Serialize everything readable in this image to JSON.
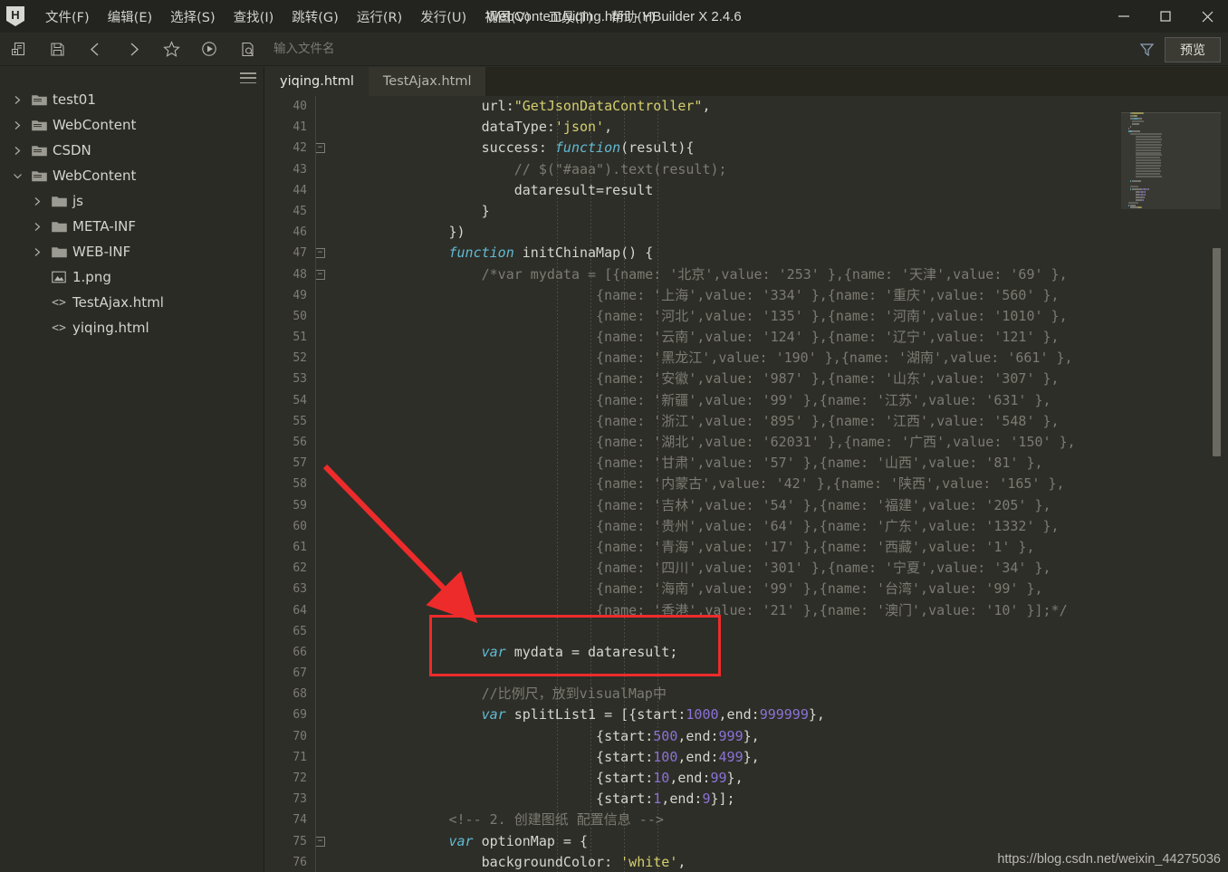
{
  "window": {
    "title": "WebContent/yiqing.html - HBuilder X 2.4.6",
    "logo_letter": "H",
    "minimize": "—",
    "maximize": "▢",
    "close": "✕"
  },
  "menubar": {
    "items": [
      {
        "label": "文件(F)",
        "name": "menu-file"
      },
      {
        "label": "编辑(E)",
        "name": "menu-edit"
      },
      {
        "label": "选择(S)",
        "name": "menu-select"
      },
      {
        "label": "查找(I)",
        "name": "menu-find"
      },
      {
        "label": "跳转(G)",
        "name": "menu-goto"
      },
      {
        "label": "运行(R)",
        "name": "menu-run"
      },
      {
        "label": "发行(U)",
        "name": "menu-publish"
      },
      {
        "label": "视图(V)",
        "name": "menu-view"
      },
      {
        "label": "工具(T)",
        "name": "menu-tools"
      },
      {
        "label": "帮助(Y)",
        "name": "menu-help"
      }
    ]
  },
  "toolbar": {
    "icons": [
      "new-file-icon",
      "save-icon",
      "back-icon",
      "forward-icon",
      "favorite-icon",
      "run-icon",
      "file-search-icon"
    ],
    "file_input_placeholder": "输入文件名",
    "file_input_value": "",
    "filter_icon": "filter-icon",
    "preview_label": "预览"
  },
  "sidebar": {
    "hamburger_icon": "menu-hamburger-icon",
    "tree": [
      {
        "label": "test01",
        "icon": "folder-icon",
        "depth": 0,
        "twisty": "collapsed"
      },
      {
        "label": "WebContent",
        "icon": "folder-icon",
        "depth": 0,
        "twisty": "collapsed"
      },
      {
        "label": "CSDN",
        "icon": "folder-icon",
        "depth": 0,
        "twisty": "collapsed"
      },
      {
        "label": "WebContent",
        "icon": "folder-icon",
        "depth": 0,
        "twisty": "expanded"
      },
      {
        "label": "js",
        "icon": "folder-icon",
        "depth": 1,
        "twisty": "collapsed"
      },
      {
        "label": "META-INF",
        "icon": "folder-icon",
        "depth": 1,
        "twisty": "collapsed"
      },
      {
        "label": "WEB-INF",
        "icon": "folder-icon",
        "depth": 1,
        "twisty": "collapsed"
      },
      {
        "label": "1.png",
        "icon": "image-icon",
        "depth": 1,
        "twisty": "none"
      },
      {
        "label": "TestAjax.html",
        "icon": "code-file-icon",
        "depth": 1,
        "twisty": "none"
      },
      {
        "label": "yiqing.html",
        "icon": "code-file-icon",
        "depth": 1,
        "twisty": "none"
      }
    ]
  },
  "editor": {
    "tabs": [
      {
        "label": "yiqing.html",
        "active": true
      },
      {
        "label": "TestAjax.html",
        "active": false
      }
    ],
    "first_line_number": 40,
    "fold_lines": [
      42,
      47,
      48,
      75
    ],
    "lines": [
      {
        "n": 40,
        "tokens": [
          {
            "t": "                    url:",
            "c": "plain"
          },
          {
            "t": "\"GetJsonDataController\"",
            "c": "str"
          },
          {
            "t": ",",
            "c": "plain"
          }
        ]
      },
      {
        "n": 41,
        "tokens": [
          {
            "t": "                    dataType:",
            "c": "plain"
          },
          {
            "t": "'json'",
            "c": "str"
          },
          {
            "t": ",",
            "c": "plain"
          }
        ]
      },
      {
        "n": 42,
        "tokens": [
          {
            "t": "                    success: ",
            "c": "plain"
          },
          {
            "t": "function",
            "c": "kw"
          },
          {
            "t": "(result){",
            "c": "plain"
          }
        ]
      },
      {
        "n": 43,
        "tokens": [
          {
            "t": "                        // $(\"#aaa\").text(result);",
            "c": "cmt"
          }
        ]
      },
      {
        "n": 44,
        "tokens": [
          {
            "t": "                        dataresult=result",
            "c": "plain"
          }
        ]
      },
      {
        "n": 45,
        "tokens": [
          {
            "t": "                    }",
            "c": "plain"
          }
        ]
      },
      {
        "n": 46,
        "tokens": [
          {
            "t": "                })",
            "c": "plain"
          }
        ]
      },
      {
        "n": 47,
        "tokens": [
          {
            "t": "                ",
            "c": "plain"
          },
          {
            "t": "function",
            "c": "kw"
          },
          {
            "t": " initChinaMap() {",
            "c": "plain"
          }
        ]
      },
      {
        "n": 48,
        "tokens": [
          {
            "t": "                    /*var mydata = [{name: '北京',value: '253' },{name: '天津',value: '69' },",
            "c": "cmt"
          }
        ]
      },
      {
        "n": 49,
        "tokens": [
          {
            "t": "                                  {name: '上海',value: '334' },{name: '重庆',value: '560' },",
            "c": "cmt"
          }
        ]
      },
      {
        "n": 50,
        "tokens": [
          {
            "t": "                                  {name: '河北',value: '135' },{name: '河南',value: '1010' },",
            "c": "cmt"
          }
        ]
      },
      {
        "n": 51,
        "tokens": [
          {
            "t": "                                  {name: '云南',value: '124' },{name: '辽宁',value: '121' },",
            "c": "cmt"
          }
        ]
      },
      {
        "n": 52,
        "tokens": [
          {
            "t": "                                  {name: '黑龙江',value: '190' },{name: '湖南',value: '661' },",
            "c": "cmt"
          }
        ]
      },
      {
        "n": 53,
        "tokens": [
          {
            "t": "                                  {name: '安徽',value: '987' },{name: '山东',value: '307' },",
            "c": "cmt"
          }
        ]
      },
      {
        "n": 54,
        "tokens": [
          {
            "t": "                                  {name: '新疆',value: '99' },{name: '江苏',value: '631' },",
            "c": "cmt"
          }
        ]
      },
      {
        "n": 55,
        "tokens": [
          {
            "t": "                                  {name: '浙江',value: '895' },{name: '江西',value: '548' },",
            "c": "cmt"
          }
        ]
      },
      {
        "n": 56,
        "tokens": [
          {
            "t": "                                  {name: '湖北',value: '62031' },{name: '广西',value: '150' },",
            "c": "cmt"
          }
        ]
      },
      {
        "n": 57,
        "tokens": [
          {
            "t": "                                  {name: '甘肃',value: '57' },{name: '山西',value: '81' },",
            "c": "cmt"
          }
        ]
      },
      {
        "n": 58,
        "tokens": [
          {
            "t": "                                  {name: '内蒙古',value: '42' },{name: '陕西',value: '165' },",
            "c": "cmt"
          }
        ]
      },
      {
        "n": 59,
        "tokens": [
          {
            "t": "                                  {name: '吉林',value: '54' },{name: '福建',value: '205' },",
            "c": "cmt"
          }
        ]
      },
      {
        "n": 60,
        "tokens": [
          {
            "t": "                                  {name: '贵州',value: '64' },{name: '广东',value: '1332' },",
            "c": "cmt"
          }
        ]
      },
      {
        "n": 61,
        "tokens": [
          {
            "t": "                                  {name: '青海',value: '17' },{name: '西藏',value: '1' },",
            "c": "cmt"
          }
        ]
      },
      {
        "n": 62,
        "tokens": [
          {
            "t": "                                  {name: '四川',value: '301' },{name: '宁夏',value: '34' },",
            "c": "cmt"
          }
        ]
      },
      {
        "n": 63,
        "tokens": [
          {
            "t": "                                  {name: '海南',value: '99' },{name: '台湾',value: '99' },",
            "c": "cmt"
          }
        ]
      },
      {
        "n": 64,
        "tokens": [
          {
            "t": "                                  {name: '香港',value: '21' },{name: '澳门',value: '10' }];*/",
            "c": "cmt"
          }
        ]
      },
      {
        "n": 65,
        "tokens": []
      },
      {
        "n": 66,
        "tokens": [
          {
            "t": "                    ",
            "c": "plain"
          },
          {
            "t": "var",
            "c": "kw"
          },
          {
            "t": " mydata = dataresult;",
            "c": "plain"
          }
        ]
      },
      {
        "n": 67,
        "tokens": []
      },
      {
        "n": 68,
        "tokens": [
          {
            "t": "                    //比例尺，放到visualMap中",
            "c": "cmt"
          }
        ]
      },
      {
        "n": 69,
        "tokens": [
          {
            "t": "                    ",
            "c": "plain"
          },
          {
            "t": "var",
            "c": "kw"
          },
          {
            "t": " splitList1 = [{start:",
            "c": "plain"
          },
          {
            "t": "1000",
            "c": "num"
          },
          {
            "t": ",end:",
            "c": "plain"
          },
          {
            "t": "999999",
            "c": "num"
          },
          {
            "t": "},",
            "c": "plain"
          }
        ]
      },
      {
        "n": 70,
        "tokens": [
          {
            "t": "                                  {start:",
            "c": "plain"
          },
          {
            "t": "500",
            "c": "num"
          },
          {
            "t": ",end:",
            "c": "plain"
          },
          {
            "t": "999",
            "c": "num"
          },
          {
            "t": "},",
            "c": "plain"
          }
        ]
      },
      {
        "n": 71,
        "tokens": [
          {
            "t": "                                  {start:",
            "c": "plain"
          },
          {
            "t": "100",
            "c": "num"
          },
          {
            "t": ",end:",
            "c": "plain"
          },
          {
            "t": "499",
            "c": "num"
          },
          {
            "t": "},",
            "c": "plain"
          }
        ]
      },
      {
        "n": 72,
        "tokens": [
          {
            "t": "                                  {start:",
            "c": "plain"
          },
          {
            "t": "10",
            "c": "num"
          },
          {
            "t": ",end:",
            "c": "plain"
          },
          {
            "t": "99",
            "c": "num"
          },
          {
            "t": "},",
            "c": "plain"
          }
        ]
      },
      {
        "n": 73,
        "tokens": [
          {
            "t": "                                  {start:",
            "c": "plain"
          },
          {
            "t": "1",
            "c": "num"
          },
          {
            "t": ",end:",
            "c": "plain"
          },
          {
            "t": "9",
            "c": "num"
          },
          {
            "t": "}];",
            "c": "plain"
          }
        ]
      },
      {
        "n": 74,
        "tokens": [
          {
            "t": "                <!-- 2. 创建图纸 配置信息 -->",
            "c": "cmt"
          }
        ]
      },
      {
        "n": 75,
        "tokens": [
          {
            "t": "                ",
            "c": "plain"
          },
          {
            "t": "var",
            "c": "kw"
          },
          {
            "t": " optionMap = {",
            "c": "plain"
          }
        ]
      },
      {
        "n": 76,
        "tokens": [
          {
            "t": "                    backgroundColor: ",
            "c": "plain"
          },
          {
            "t": "'white'",
            "c": "str"
          },
          {
            "t": ",",
            "c": "plain"
          }
        ]
      }
    ]
  },
  "annotations": {
    "highlight_box": {
      "label": "red-rectangle-highlight",
      "color": "#ee2b2b"
    },
    "arrow": {
      "label": "red-arrow-pointer",
      "color": "#ee2b2b"
    }
  },
  "watermark": {
    "text": "https://blog.csdn.net/weixin_44275036"
  },
  "colors": {
    "app_bg": "#2e2e28",
    "titlebar_bg": "#23231f",
    "accent_red": "#ee2b2b",
    "keyword": "#60bbd4",
    "string": "#d4cf6e",
    "number": "#8b72d6",
    "comment": "#7b7b73"
  }
}
